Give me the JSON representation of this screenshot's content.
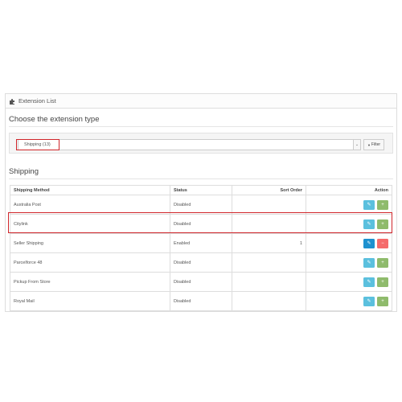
{
  "panel": {
    "title": "Extension List"
  },
  "choose": {
    "heading": "Choose the extension type"
  },
  "filter": {
    "selected": "Shipping (13)",
    "button_label": "Filter",
    "caret": "⌄",
    "filter_icon": "▼"
  },
  "section": {
    "heading": "Shipping"
  },
  "table": {
    "headers": {
      "method": "Shipping Method",
      "status": "Status",
      "sort": "Sort Order",
      "action": "Action"
    },
    "rows": [
      {
        "method": "Australia Post",
        "status": "Disabled",
        "sort": "",
        "installed": false
      },
      {
        "method": "Citylink",
        "status": "Disabled",
        "sort": "",
        "installed": false
      },
      {
        "method": "Seller Shipping",
        "status": "Enabled",
        "sort": "1",
        "installed": true
      },
      {
        "method": "Parcelforce 48",
        "status": "Disabled",
        "sort": "",
        "installed": false
      },
      {
        "method": "Pickup From Store",
        "status": "Disabled",
        "sort": "",
        "installed": false
      },
      {
        "method": "Royal Mail",
        "status": "Disabled",
        "sort": "",
        "installed": false
      }
    ]
  },
  "icons": {
    "edit": "✎",
    "add": "+",
    "remove": "−"
  },
  "colors": {
    "edit": "#5bc0de",
    "edit_active": "#1e91cf",
    "add": "#8fbb6c",
    "remove": "#f56b6b",
    "highlight": "#d0262b"
  }
}
